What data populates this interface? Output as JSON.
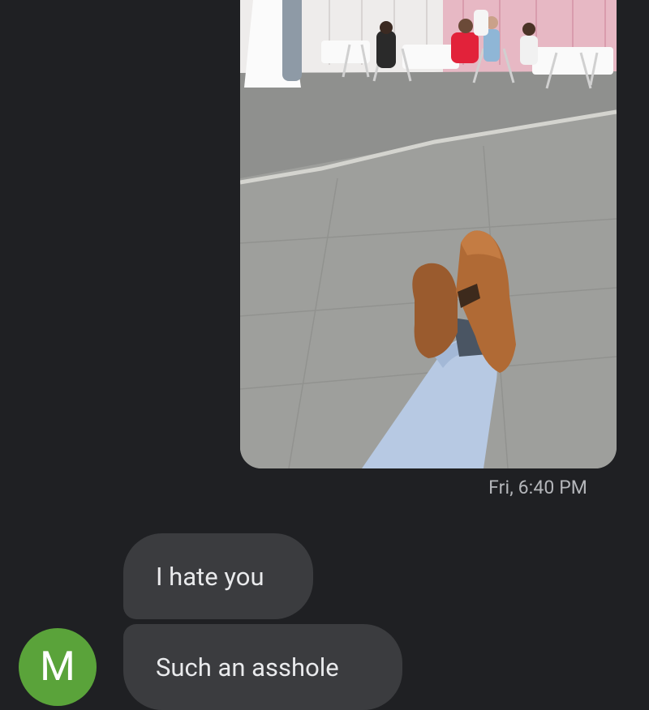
{
  "thread": {
    "sent_photo": {
      "timestamp": "Fri, 6:40 PM"
    },
    "received": [
      {
        "text": "I hate you"
      },
      {
        "text": "Such an asshole"
      }
    ],
    "contact": {
      "initial": "M",
      "avatar_color": "#5aa33a"
    }
  },
  "colors": {
    "background": "#1f2023",
    "received_bubble": "#3b3c3f",
    "received_text": "#e9eaec",
    "timestamp_text": "#b4b6ba"
  }
}
